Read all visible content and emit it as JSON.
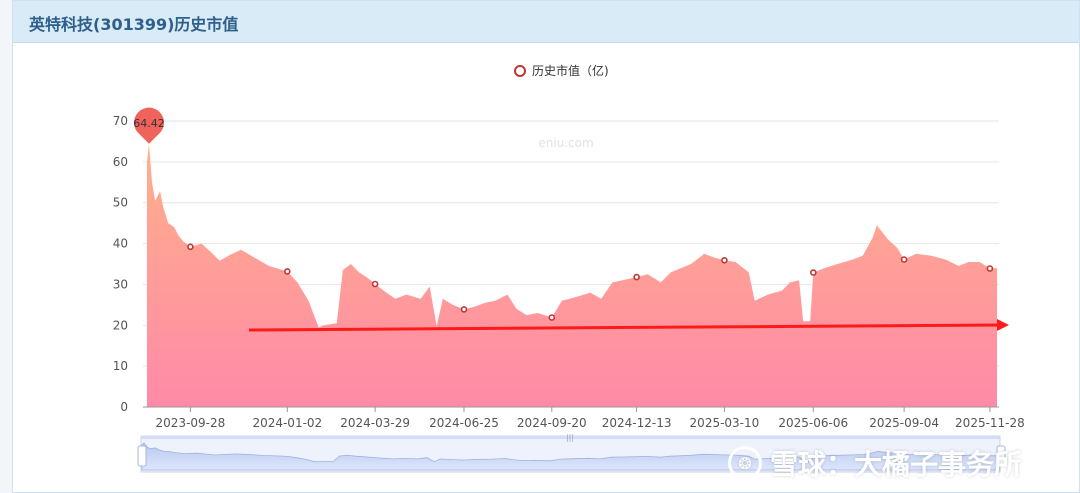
{
  "panel": {
    "title": "英特科技(301399)历史市值"
  },
  "watermark": "eniu.com",
  "brand_watermark": "雪球：大橘子事务所",
  "colors": {
    "area_top": "#ffb08a",
    "area_bottom": "#ff8aa8",
    "marker": "#c23531",
    "pin": "#f0625c",
    "arrow": "#ff1a1a",
    "zoom_fill": "#dde6fb"
  },
  "chart_data": {
    "type": "area",
    "title": "",
    "legend": [
      "历史市值（亿)"
    ],
    "legend_position": "top-center",
    "ylim": [
      0,
      70
    ],
    "yticks": [
      0,
      10,
      20,
      30,
      40,
      50,
      60,
      70
    ],
    "grid": true,
    "x_tick_labels": [
      "2023-09-28",
      "2024-01-02",
      "2024-03-29",
      "2024-06-25",
      "2024-09-20",
      "2024-12-13",
      "2025-03-10",
      "2025-06-06",
      "2025-09-04",
      "2025-11-28"
    ],
    "max_label": {
      "date": "2023-08-18",
      "value": 64.42,
      "text": "64.42"
    },
    "marked_points": [
      {
        "date": "2023-09-28",
        "value": 39.2
      },
      {
        "date": "2024-01-02",
        "value": 33.2
      },
      {
        "date": "2024-03-29",
        "value": 30.1
      },
      {
        "date": "2024-06-25",
        "value": 23.9
      },
      {
        "date": "2024-09-20",
        "value": 21.9
      },
      {
        "date": "2024-12-13",
        "value": 31.8
      },
      {
        "date": "2025-03-10",
        "value": 35.9
      },
      {
        "date": "2025-06-06",
        "value": 32.9
      },
      {
        "date": "2025-09-04",
        "value": 36.1
      },
      {
        "date": "2025-11-28",
        "value": 33.9
      }
    ],
    "series": [
      {
        "name": "历史市值（亿)",
        "points": [
          [
            "2023-08-16",
            60.0
          ],
          [
            "2023-08-18",
            64.4
          ],
          [
            "2023-08-21",
            55.0
          ],
          [
            "2023-08-24",
            50.5
          ],
          [
            "2023-08-29",
            52.8
          ],
          [
            "2023-09-01",
            49.0
          ],
          [
            "2023-09-06",
            45.0
          ],
          [
            "2023-09-12",
            44.0
          ],
          [
            "2023-09-16",
            42.0
          ],
          [
            "2023-09-21",
            40.5
          ],
          [
            "2023-09-28",
            39.2
          ],
          [
            "2023-10-09",
            40.0
          ],
          [
            "2023-10-18",
            38.0
          ],
          [
            "2023-10-27",
            35.8
          ],
          [
            "2023-11-06",
            37.2
          ],
          [
            "2023-11-17",
            38.5
          ],
          [
            "2023-12-01",
            36.5
          ],
          [
            "2023-12-15",
            34.5
          ],
          [
            "2024-01-02",
            33.2
          ],
          [
            "2024-01-12",
            30.5
          ],
          [
            "2024-01-23",
            26.0
          ],
          [
            "2024-02-02",
            19.5
          ],
          [
            "2024-02-08",
            20.0
          ],
          [
            "2024-02-20",
            20.5
          ],
          [
            "2024-02-26",
            33.5
          ],
          [
            "2024-03-05",
            35.0
          ],
          [
            "2024-03-13",
            33.0
          ],
          [
            "2024-03-22",
            31.5
          ],
          [
            "2024-03-29",
            30.1
          ],
          [
            "2024-04-09",
            28.0
          ],
          [
            "2024-04-18",
            26.5
          ],
          [
            "2024-04-29",
            27.5
          ],
          [
            "2024-05-13",
            26.5
          ],
          [
            "2024-05-22",
            29.5
          ],
          [
            "2024-05-29",
            19.8
          ],
          [
            "2024-06-04",
            26.5
          ],
          [
            "2024-06-14",
            25.0
          ],
          [
            "2024-06-25",
            23.9
          ],
          [
            "2024-07-05",
            24.5
          ],
          [
            "2024-07-16",
            25.5
          ],
          [
            "2024-07-26",
            26.0
          ],
          [
            "2024-08-07",
            27.5
          ],
          [
            "2024-08-16",
            24.0
          ],
          [
            "2024-08-26",
            22.5
          ],
          [
            "2024-09-06",
            23.0
          ],
          [
            "2024-09-20",
            21.9
          ],
          [
            "2024-09-30",
            26.0
          ],
          [
            "2024-10-15",
            27.0
          ],
          [
            "2024-10-28",
            28.0
          ],
          [
            "2024-11-08",
            26.5
          ],
          [
            "2024-11-19",
            30.5
          ],
          [
            "2024-11-29",
            31.0
          ],
          [
            "2024-12-13",
            31.8
          ],
          [
            "2024-12-24",
            32.5
          ],
          [
            "2025-01-06",
            30.5
          ],
          [
            "2025-01-16",
            33.0
          ],
          [
            "2025-02-05",
            35.0
          ],
          [
            "2025-02-18",
            37.5
          ],
          [
            "2025-03-01",
            36.5
          ],
          [
            "2025-03-10",
            35.9
          ],
          [
            "2025-03-21",
            35.5
          ],
          [
            "2025-04-03",
            33.0
          ],
          [
            "2025-04-09",
            26.0
          ],
          [
            "2025-04-22",
            27.5
          ],
          [
            "2025-05-06",
            28.5
          ],
          [
            "2025-05-14",
            30.5
          ],
          [
            "2025-05-23",
            31.0
          ],
          [
            "2025-05-27",
            21.0
          ],
          [
            "2025-06-03",
            21.0
          ],
          [
            "2025-06-06",
            32.9
          ],
          [
            "2025-06-17",
            34.0
          ],
          [
            "2025-06-30",
            35.0
          ],
          [
            "2025-07-14",
            36.0
          ],
          [
            "2025-07-25",
            37.0
          ],
          [
            "2025-08-04",
            41.5
          ],
          [
            "2025-08-08",
            44.5
          ],
          [
            "2025-08-19",
            41.0
          ],
          [
            "2025-08-28",
            39.0
          ],
          [
            "2025-09-04",
            36.1
          ],
          [
            "2025-09-16",
            37.5
          ],
          [
            "2025-10-01",
            37.0
          ],
          [
            "2025-10-16",
            36.0
          ],
          [
            "2025-10-28",
            34.5
          ],
          [
            "2025-11-07",
            35.5
          ],
          [
            "2025-11-18",
            35.5
          ],
          [
            "2025-11-24",
            34.5
          ],
          [
            "2025-11-28",
            33.9
          ],
          [
            "2025-12-05",
            34.0
          ]
        ]
      }
    ]
  }
}
